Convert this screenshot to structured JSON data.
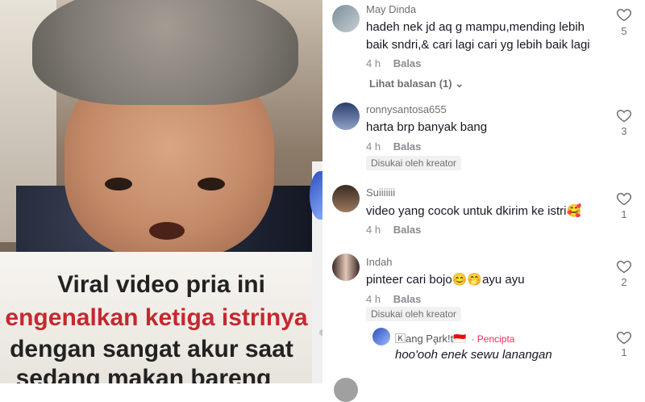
{
  "video": {
    "caption_lines": [
      "Viral video pria ini",
      "engenalkan ketiga istrinya",
      "dengan sangat akur saat",
      "sedang makan bareng"
    ]
  },
  "comments": [
    {
      "user": "May Dinda",
      "text_lines": [
        "hadeh nek jd aq g mampu,mending lebih",
        "baik sndri,& cari lagi cari yg lebih baik lagi"
      ],
      "time": "4 h",
      "reply_label": "Balas",
      "likes": "5",
      "view_replies": "Lihat balasan (1)"
    },
    {
      "user": "ronnysantosa655",
      "text_lines": [
        "harta brp banyak bang"
      ],
      "time": "4 h",
      "reply_label": "Balas",
      "likes": "3",
      "liked_by_creator": "Disukai oleh kreator"
    },
    {
      "user": "Suiiiiiii",
      "text_lines": [
        "video yang cocok untuk dkirim ke istri🥰"
      ],
      "time": "4 h",
      "reply_label": "Balas",
      "likes": "1"
    },
    {
      "user": "Indah",
      "text_lines": [
        "pinteer cari bojo😊🤭ayu ayu"
      ],
      "time": "4 h",
      "reply_label": "Balas",
      "likes": "2",
      "liked_by_creator": "Disukai oleh kreator"
    }
  ],
  "creator_reply": {
    "user": "🄺ang Pa̧rk!t🇮🇩",
    "badge": "· Pencipta",
    "text": "hoo'ooh enek sewu lanangan",
    "likes": "1"
  },
  "colors": {
    "accent": "#fe2c55",
    "text": "#161823",
    "muted": "#8a8b91"
  }
}
